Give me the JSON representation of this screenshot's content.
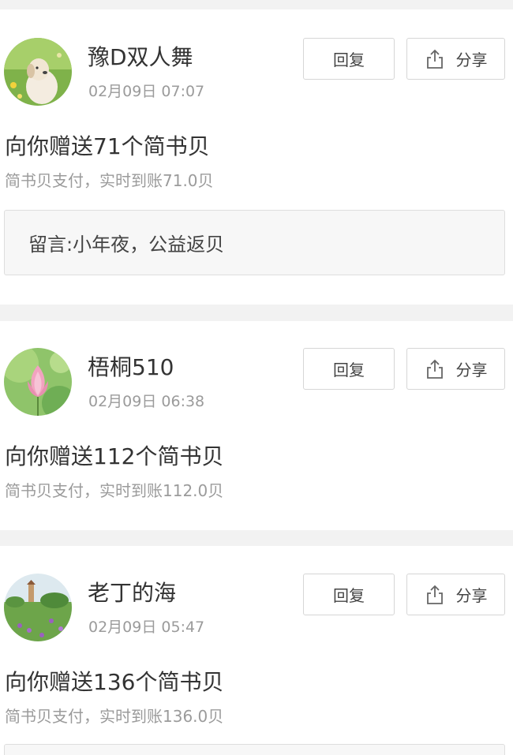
{
  "buttons": {
    "reply_label": "回复",
    "share_label": "分享"
  },
  "icons": {
    "share": "share-icon"
  },
  "colors": {
    "background_gap": "#f2f2f2",
    "secondary_text": "#9b9b9b",
    "border": "#d6d6d6",
    "message_bg": "#f7f7f7"
  },
  "items": [
    {
      "username": "豫D双人舞",
      "time": "02月09日 07:07",
      "title": "向你赠送71个简书贝",
      "subtitle": "简书贝支付，实时到账71.0贝",
      "message": "留言:小年夜，公益返贝",
      "avatar": "puppy-in-flowers"
    },
    {
      "username": "梧桐510",
      "time": "02月09日 06:38",
      "title": "向你赠送112个简书贝",
      "subtitle": "简书贝支付，实时到账112.0贝",
      "avatar": "pink-lotus"
    },
    {
      "username": "老丁的海",
      "time": "02月09日 05:47",
      "title": "向你赠送136个简书贝",
      "subtitle": "简书贝支付，实时到账136.0贝",
      "avatar": "windmill-meadow"
    }
  ]
}
